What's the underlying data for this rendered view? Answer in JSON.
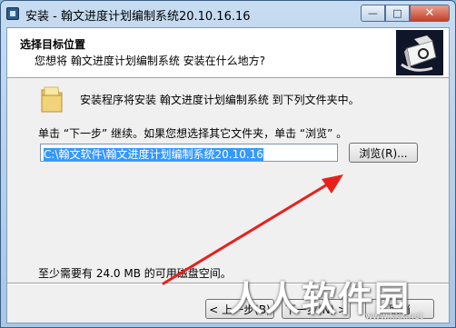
{
  "window": {
    "title": "安装 - 翰文进度计划编制系统20.10.16.16",
    "buttons": {
      "minimize": "—",
      "maximize": "□",
      "close": "✕"
    }
  },
  "header": {
    "title": "选择目标位置",
    "subtitle": "您想将 翰文进度计划编制系统 安装在什么地方?"
  },
  "body": {
    "install_message": "安装程序将安装 翰文进度计划编制系统 到下列文件夹中。",
    "instruction": "单击 “下一步” 继续。如果您想选择其它文件夹，单击 “浏览” 。",
    "path_value": "C:\\翰文软件\\翰文进度计划编制系统20.10.16",
    "browse_label": "浏览(R)...",
    "space_message": "至少需要有 24.0 MB 的可用磁盘空间。"
  },
  "footer": {
    "back_label": "< 上一步(B)",
    "next_label": "下一步(N) >",
    "cancel_label": "取消"
  },
  "watermark": {
    "text": "人人软件园",
    "url": "www.kkx.net"
  },
  "colors": {
    "arrow": "#e8201c",
    "selection": "#3399ff"
  }
}
